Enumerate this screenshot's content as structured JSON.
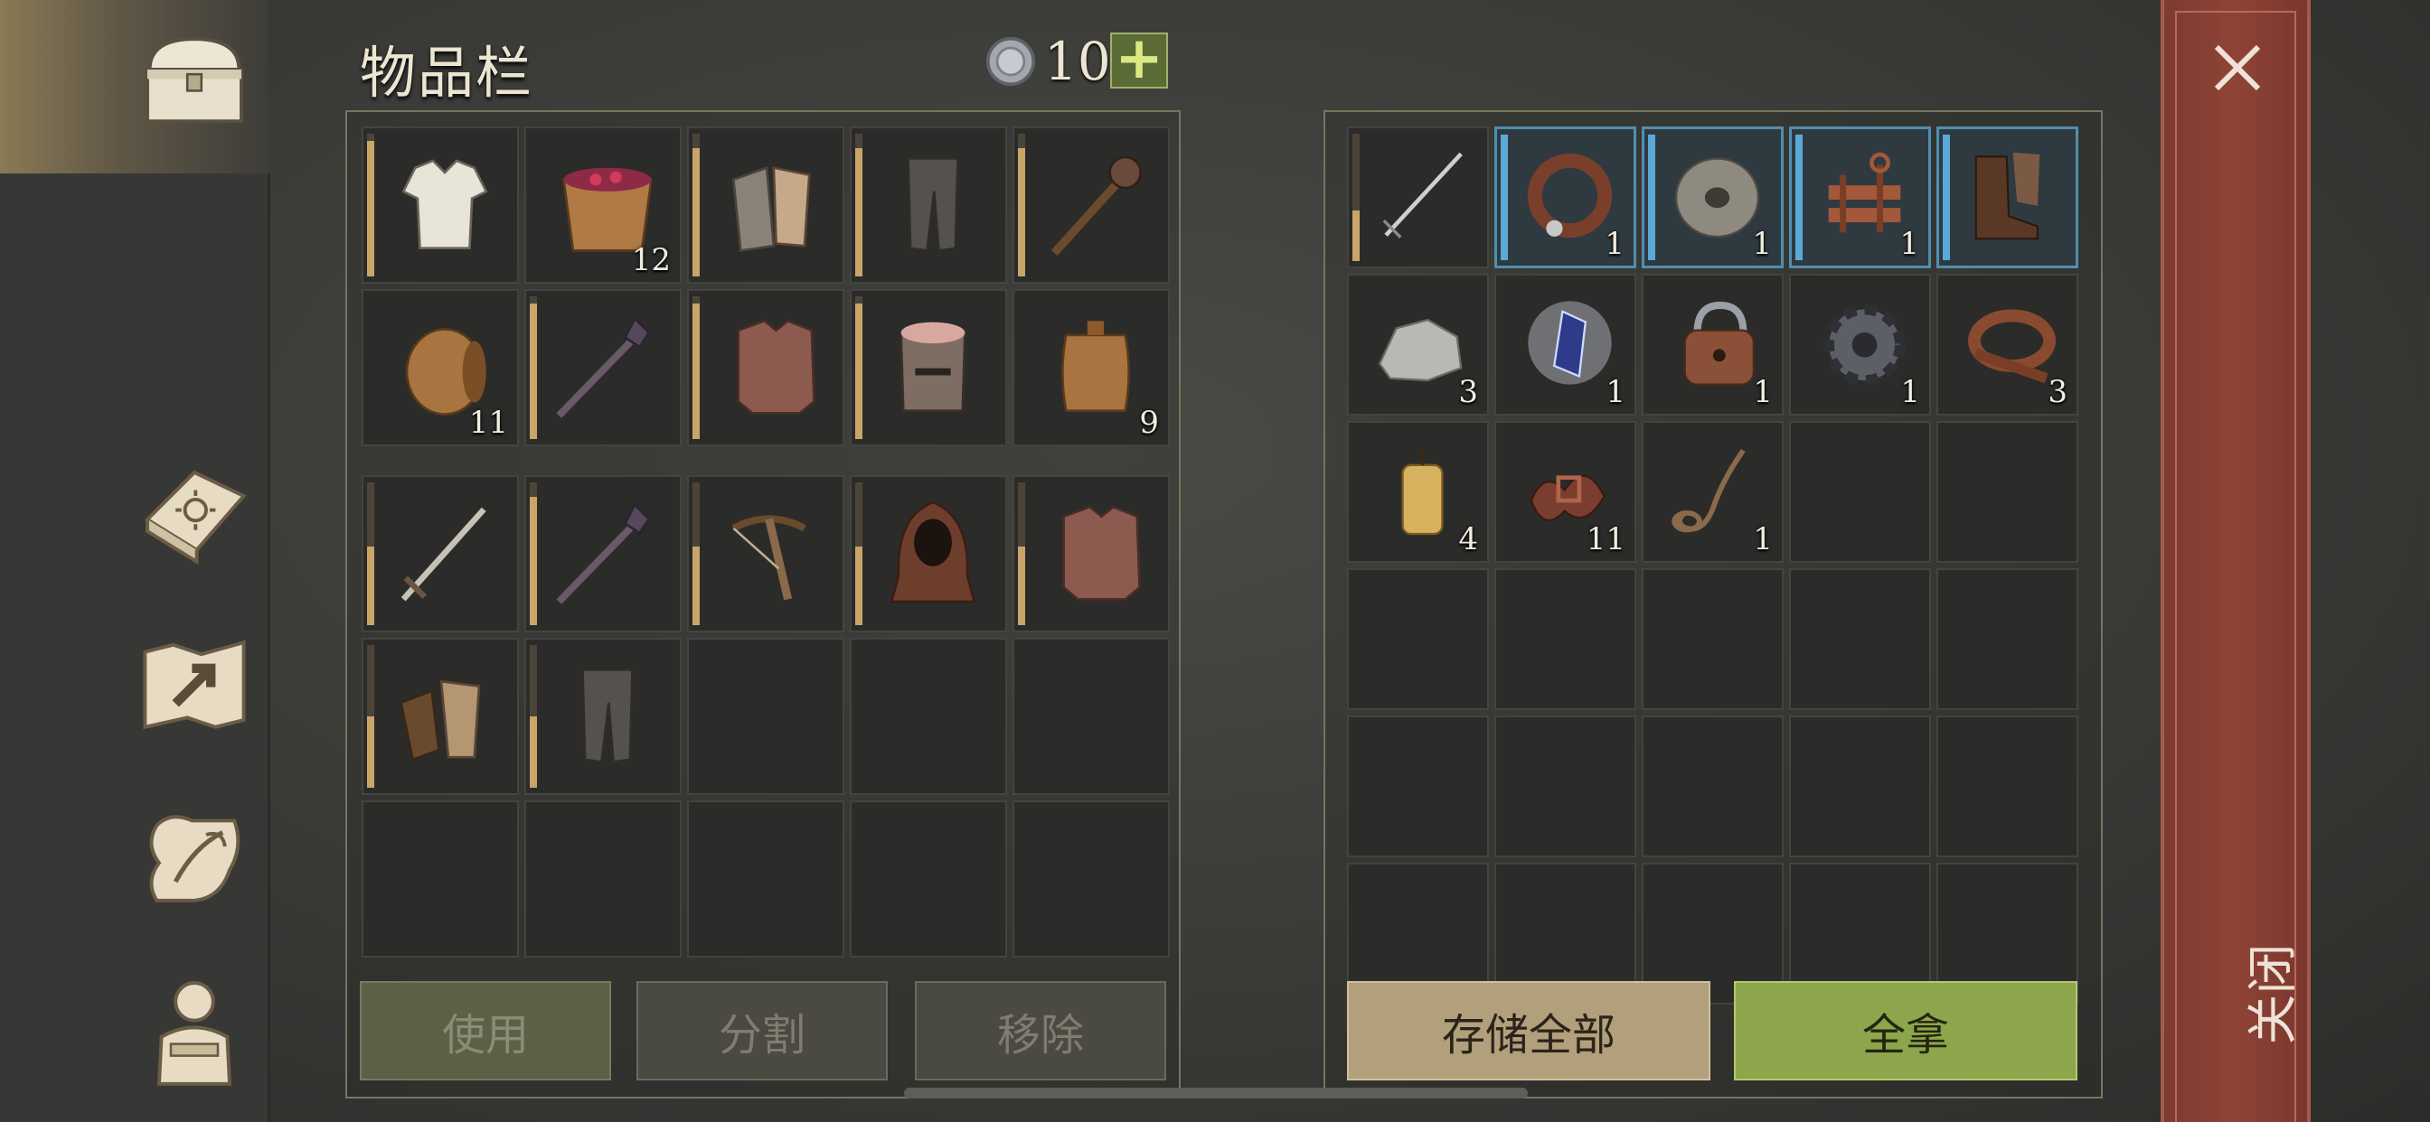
{
  "header": {
    "title": "物品栏",
    "currency_count": "10",
    "add_currency_label": "+"
  },
  "nav": {
    "items": [
      {
        "name": "chest-icon",
        "active": true
      },
      {
        "name": "recipe-book-icon"
      },
      {
        "name": "map-icon"
      },
      {
        "name": "quest-scroll-icon"
      },
      {
        "name": "character-equipment-icon"
      }
    ]
  },
  "inventory": {
    "grid1": [
      {
        "icon": "shirt-icon",
        "qty": "",
        "durability": 0.95
      },
      {
        "icon": "berry-bucket-icon",
        "qty": "12",
        "durability": null
      },
      {
        "icon": "chainmail-gloves-icon",
        "qty": "",
        "durability": 0.9
      },
      {
        "icon": "chain-leggings-icon",
        "qty": "",
        "durability": 0.9
      },
      {
        "icon": "mace-icon",
        "qty": "",
        "durability": 0.9
      },
      {
        "icon": "barrel-icon",
        "qty": "11",
        "durability": null
      },
      {
        "icon": "spiked-mace-icon",
        "qty": "",
        "durability": 0.95
      },
      {
        "icon": "chainmail-shirt-icon",
        "qty": "",
        "durability": 0.95
      },
      {
        "icon": "great-helm-icon",
        "qty": "",
        "durability": 0.95
      },
      {
        "icon": "keg-icon",
        "qty": "9",
        "durability": null
      }
    ],
    "grid2": [
      {
        "icon": "sword-icon",
        "qty": "",
        "durability": 0.55
      },
      {
        "icon": "spiked-mace-icon",
        "qty": "",
        "durability": 0.9
      },
      {
        "icon": "crossbow-icon",
        "qty": "",
        "durability": 0.55
      },
      {
        "icon": "hood-icon",
        "qty": "",
        "durability": 0.55
      },
      {
        "icon": "chainmail-shirt-icon",
        "qty": "",
        "durability": 0.55
      },
      {
        "icon": "leather-gloves-icon",
        "qty": "",
        "durability": 0.5
      },
      {
        "icon": "chain-leggings-icon",
        "qty": "",
        "durability": 0.5
      },
      {},
      {},
      {},
      {},
      {},
      {},
      {},
      {}
    ],
    "buttons": {
      "use": "使用",
      "split": "分割",
      "remove": "移除"
    }
  },
  "container": {
    "items": [
      {
        "icon": "long-sword-icon",
        "qty": "",
        "durability": 0.4,
        "rare": false
      },
      {
        "icon": "leather-collar-icon",
        "qty": "1",
        "rare": true
      },
      {
        "icon": "whetstone-icon",
        "qty": "1",
        "rare": true
      },
      {
        "icon": "mechanism-icon",
        "qty": "1",
        "rare": true
      },
      {
        "icon": "leather-boots-icon",
        "qty": "",
        "rare": true
      },
      {
        "icon": "stone-ore-icon",
        "qty": "3"
      },
      {
        "icon": "crystal-icon",
        "qty": "1"
      },
      {
        "icon": "padlock-icon",
        "qty": "1"
      },
      {
        "icon": "gear-icon",
        "qty": "1"
      },
      {
        "icon": "leather-strap-icon",
        "qty": "3"
      },
      {
        "icon": "candle-icon",
        "qty": "4"
      },
      {
        "icon": "copper-scraps-icon",
        "qty": "11"
      },
      {
        "icon": "rope-icon",
        "qty": "1"
      },
      {},
      {},
      {},
      {},
      {},
      {},
      {},
      {},
      {},
      {},
      {},
      {},
      {},
      {},
      {},
      {},
      {}
    ],
    "buttons": {
      "store_all": "存储全部",
      "take_all": "全拿"
    }
  },
  "close": {
    "label": "关闭"
  }
}
